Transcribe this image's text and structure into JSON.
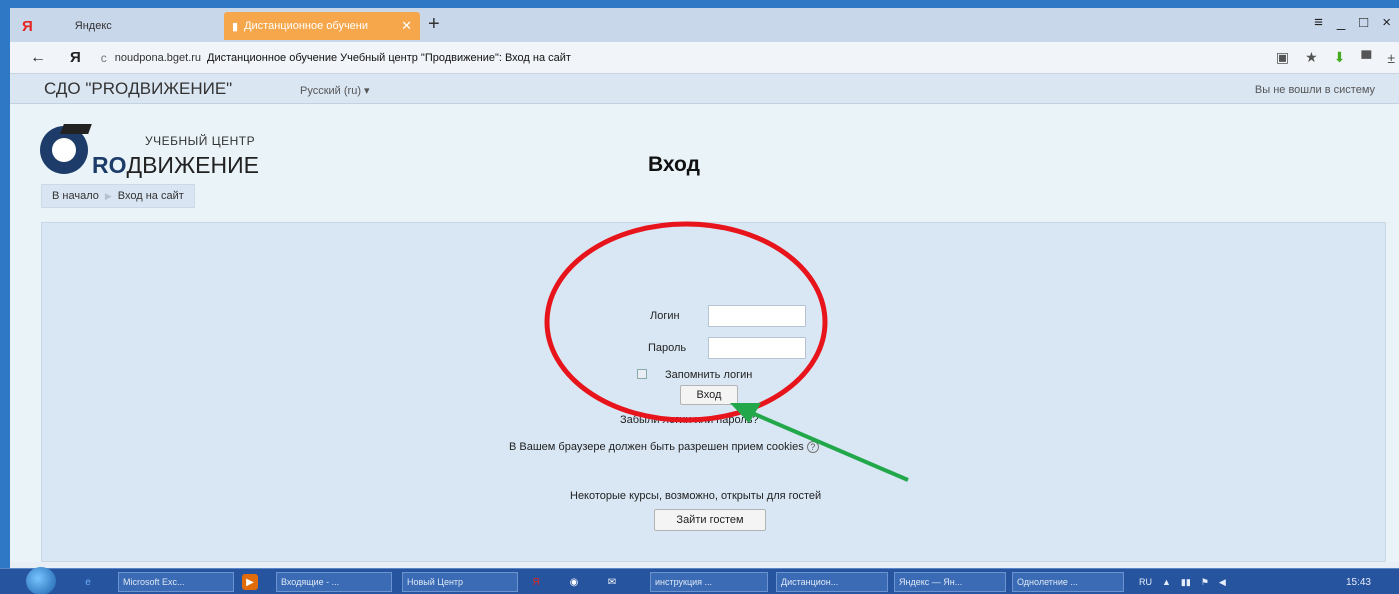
{
  "browser": {
    "tabs": [
      {
        "label": "Яндекс"
      },
      {
        "label": "Дистанционное обучени"
      }
    ],
    "address": {
      "domain": "noudpona.bget.ru",
      "page_title": "Дистанционное обучение Учебный центр \"Продвижение\": Вход на сайт"
    }
  },
  "site": {
    "brand": "СДО \"PROДВИЖЕНИЕ\"",
    "language": "Русский (ru) ▾",
    "login_status": "Вы не вошли в систему",
    "logo": {
      "subtitle": "УЧЕБНЫЙ ЦЕНТР",
      "name_bold": "RO",
      "name_rest": "ДВИЖЕНИЕ"
    },
    "breadcrumb": [
      "В начало",
      "Вход на сайт"
    ]
  },
  "login": {
    "title": "Вход",
    "username_label": "Логин",
    "password_label": "Пароль",
    "username_value": "",
    "password_value": "",
    "remember_label": "Запомнить логин",
    "submit_label": "Вход",
    "forgot_link": "Забыли логин или пароль?",
    "cookies_note": "В Вашем браузере должен быть разрешен прием cookies",
    "guest_note": "Некоторые курсы, возможно, открыты для гостей",
    "guest_button": "Зайти гостем"
  },
  "taskbar": {
    "items": [
      "Microsoft Exc...",
      "Входящие - ...",
      "Новый Центр",
      "инструкция ...",
      "Дистанцион...",
      "Яндекс — Ян...",
      "Однолетние ..."
    ],
    "language": "RU",
    "clock": "15:43"
  },
  "annotation_colors": {
    "circle": "#e8141b",
    "arrow": "#22a84a"
  }
}
